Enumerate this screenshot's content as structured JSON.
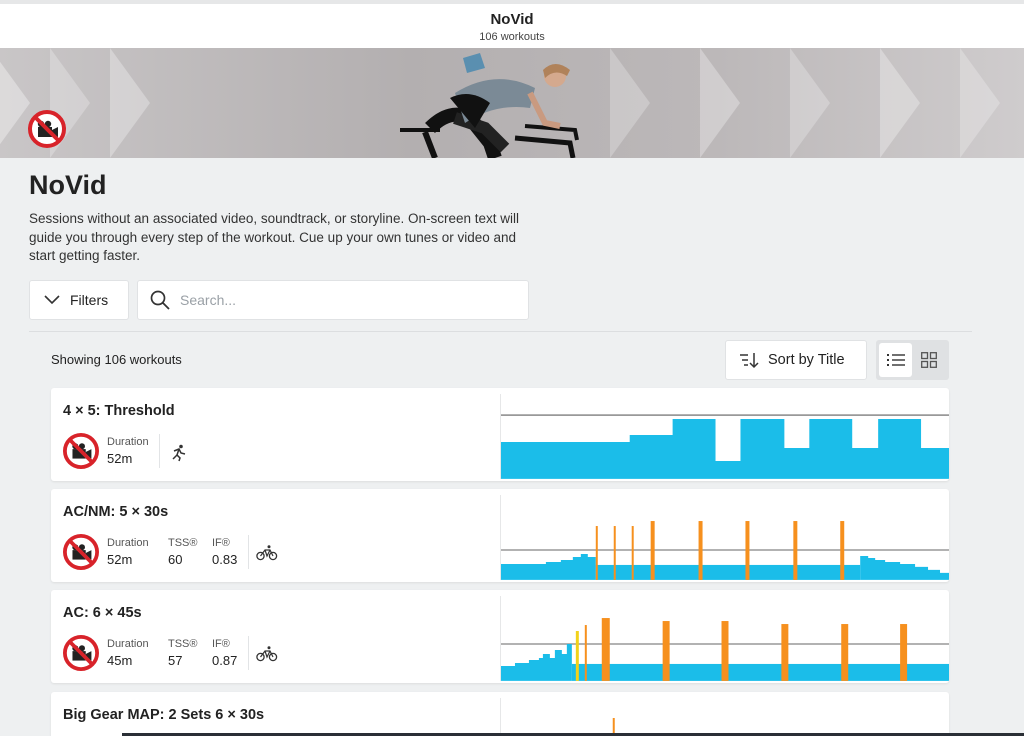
{
  "header": {
    "title": "NoVid",
    "subtitle": "106 workouts"
  },
  "page": {
    "title": "NoVid",
    "description": "Sessions without an associated video, soundtrack, or storyline. On-screen text will guide you through every step of the workout. Cue up your own tunes or video and start getting faster."
  },
  "toolbar": {
    "filters_label": "Filters",
    "search_placeholder": "Search...",
    "showing_label": "Showing 106 workouts",
    "sort_label": "Sort by Title"
  },
  "colors": {
    "accent_blue": "#1bbde9",
    "interval_orange": "#f6901e",
    "interval_yellow": "#f2d21a",
    "badge_red": "#d8232a"
  },
  "workouts": [
    {
      "title": "4 × 5: Threshold",
      "duration_label": "Duration",
      "duration": "52m",
      "sport": "run"
    },
    {
      "title": "AC/NM: 5 × 30s",
      "duration_label": "Duration",
      "duration": "52m",
      "tss_label": "TSS®",
      "tss": "60",
      "if_label": "IF®",
      "if": "0.83",
      "sport": "bike"
    },
    {
      "title": "AC: 6 × 45s",
      "duration_label": "Duration",
      "duration": "45m",
      "tss_label": "TSS®",
      "tss": "57",
      "if_label": "IF®",
      "if": "0.87",
      "sport": "bike"
    },
    {
      "title": "Big Gear MAP: 2 Sets 6 × 30s"
    }
  ]
}
